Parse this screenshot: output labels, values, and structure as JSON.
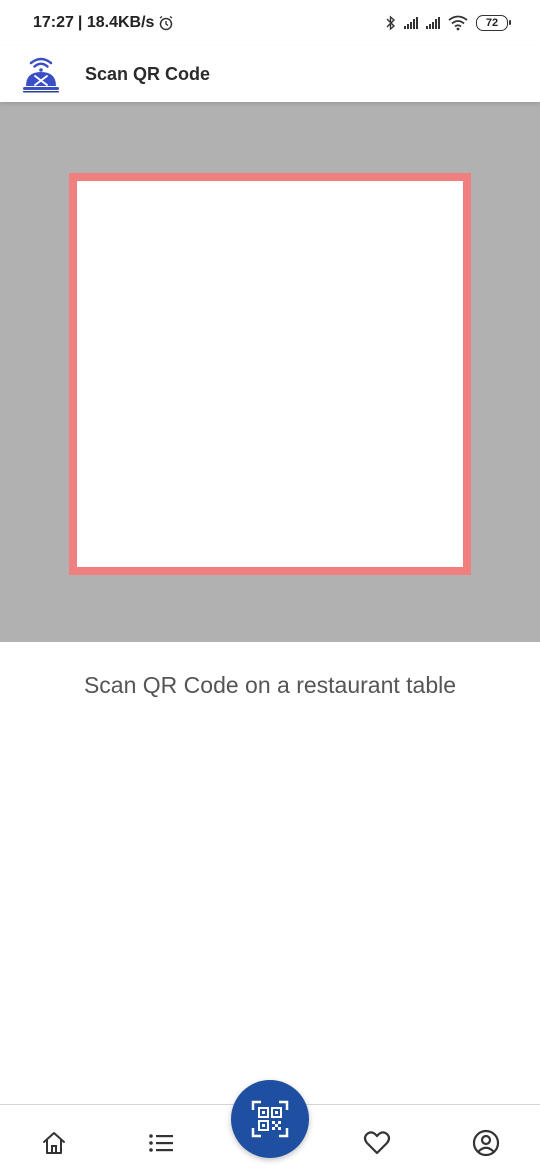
{
  "status_bar": {
    "time": "17:27",
    "network_speed": "| 18.4KB/s",
    "battery": "72",
    "icons": [
      "alarm-icon",
      "bluetooth-icon",
      "signal-icon",
      "wifi-icon",
      "battery-icon"
    ]
  },
  "app_bar": {
    "title": "Scan QR Code",
    "logo_icon": "restaurant-wifi-logo-icon"
  },
  "scanner": {
    "instruction": "Scan QR Code on a restaurant table"
  },
  "bottom_nav": {
    "items": [
      {
        "icon": "home-icon"
      },
      {
        "icon": "list-icon"
      },
      {
        "icon": "qr-code-icon"
      },
      {
        "icon": "heart-icon"
      },
      {
        "icon": "account-icon"
      }
    ]
  },
  "colors": {
    "scan_frame": "#f08080",
    "camera_background": "#b1b1b1",
    "fab": "#1e4fa0",
    "logo": "#3a4fc4"
  }
}
